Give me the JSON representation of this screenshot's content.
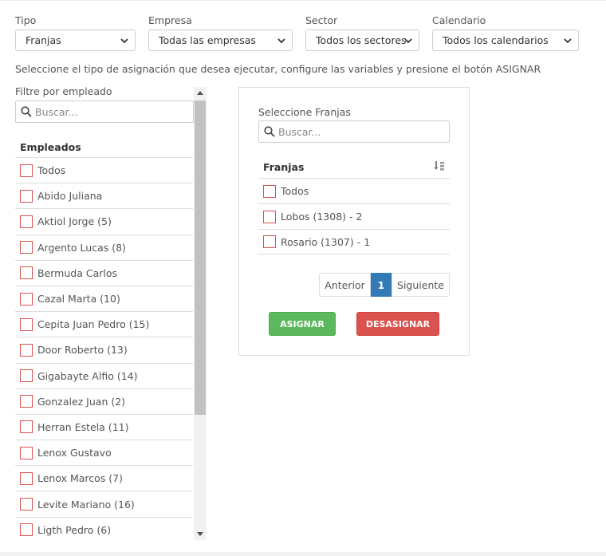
{
  "filters": {
    "tipo": {
      "label": "Tipo",
      "value": "Franjas"
    },
    "empresa": {
      "label": "Empresa",
      "value": "Todas las empresas"
    },
    "sector": {
      "label": "Sector",
      "value": "Todos los sectores"
    },
    "calendario": {
      "label": "Calendario",
      "value": "Todos los calendarios"
    }
  },
  "instruction": "Seleccione el tipo de asignación que desea ejecutar, configure las variables y presione el botón ASIGNAR",
  "employees": {
    "filter_label": "Filtre por empleado",
    "search_placeholder": "Buscar...",
    "header": "Empleados",
    "items": [
      "Todos",
      "Abido Juliana",
      "Aktiol Jorge (5)",
      "Argento Lucas (8)",
      "Bermuda Carlos",
      "Cazal Marta (10)",
      "Cepita Juan Pedro (15)",
      "Door Roberto (13)",
      "Gigabayte Alfio (14)",
      "Gonzalez Juan (2)",
      "Herran Estela (11)",
      "Lenox Gustavo",
      "Lenox Marcos (7)",
      "Levite Mariano (16)",
      "Ligth Pedro (6)"
    ]
  },
  "franjas": {
    "title": "Seleccione Franjas",
    "search_placeholder": "Buscar...",
    "header": "Franjas",
    "items": [
      "Todos",
      "Lobos (1308) - 2",
      "Rosario (1307) - 1"
    ]
  },
  "pagination": {
    "prev": "Anterior",
    "current": "1",
    "next": "Siguiente"
  },
  "actions": {
    "assign": "ASIGNAR",
    "unassign": "DESASIGNAR"
  },
  "colors": {
    "assign": "#5cb85c",
    "unassign": "#d9534f",
    "page_active": "#337ab7",
    "checkbox_border": "#d9534f"
  }
}
